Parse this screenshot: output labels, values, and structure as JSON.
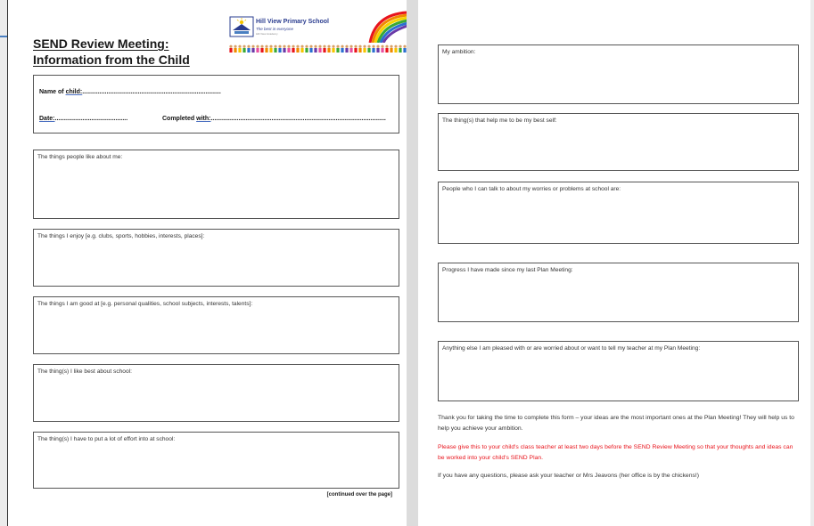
{
  "left_page": {
    "title_line1": "SEND Review Meeting:",
    "title_line2": "Information from the Child",
    "logo": {
      "school_name": "Hill View Primary School",
      "motto": "The best in everyone",
      "small_text": "Hill View Academy"
    },
    "info": {
      "name_label": "Name of child:",
      "name_dots": "................................................................................",
      "date_label": "Date:",
      "date_dots": "..........................................",
      "completed_label": "Completed with:",
      "completed_dots": "....................................................................................................."
    },
    "boxes": [
      {
        "label": "The things people like about me:"
      },
      {
        "label": "The things I enjoy [e.g. clubs, sports, hobbies, interests, places]:"
      },
      {
        "label": "The things I am good at [e.g. personal qualities, school subjects, interests, talents]:"
      },
      {
        "label": "The thing(s) I like best about school:"
      },
      {
        "label": "The thing(s) I have to put a lot of effort into at school:"
      }
    ],
    "continued": "[continued over the page]"
  },
  "right_page": {
    "boxes": [
      {
        "label": "My ambition:"
      },
      {
        "label": "The thing(s) that help me to be my best self:"
      },
      {
        "label": "People who I can talk to about my worries or problems at school are:"
      },
      {
        "label": "Progress I have made since my last Plan Meeting:"
      },
      {
        "label": "Anything else I am pleased with or are worried about or want to tell my teacher at my Plan Meeting:"
      }
    ],
    "footer": {
      "thanks": "Thank you for taking the time to complete this form – your ideas are the most important ones at the Plan Meeting! They will help us to help you achieve your ambition.",
      "instruction": "Please give this to your child's class teacher at least two days before the SEND Review Meeting so that your thoughts and ideas can be worked into your child's SEND Plan.",
      "questions": "If you have any questions, please ask your teacher or Mrs Jeavons (her office is by the chickens!)"
    }
  },
  "colors": {
    "accent_red": "#e8141c",
    "logo_blue": "#2a3c8f"
  }
}
